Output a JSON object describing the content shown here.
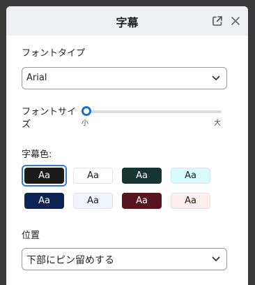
{
  "dialog": {
    "title": "字幕",
    "icons": {
      "popout": "external-link-icon",
      "close": "close-icon"
    }
  },
  "font_type": {
    "label": "フォントタイプ",
    "selected": "Arial"
  },
  "font_size": {
    "label": "フォントサイズ",
    "min_label": "小",
    "max_label": "大",
    "level": 0
  },
  "caption_color": {
    "label": "字幕色:",
    "selected_index": 0,
    "swatches": [
      {
        "text": "Aa",
        "bg": "#1b1b1b",
        "fg": "#ffffff"
      },
      {
        "text": "Aa",
        "bg": "#ffffff",
        "fg": "#1b1b1b"
      },
      {
        "text": "Aa",
        "bg": "#143530",
        "fg": "#ffffff"
      },
      {
        "text": "Aa",
        "bg": "#d6fbfb",
        "fg": "#1b1b1b"
      },
      {
        "text": "Aa",
        "bg": "#0f2352",
        "fg": "#ffffff"
      },
      {
        "text": "Aa",
        "bg": "#eef3ff",
        "fg": "#1b1b1b"
      },
      {
        "text": "Aa",
        "bg": "#571420",
        "fg": "#ffffff"
      },
      {
        "text": "Aa",
        "bg": "#fdeeee",
        "fg": "#1b1b1b"
      }
    ]
  },
  "position": {
    "label": "位置",
    "selected": "下部にピン留めする"
  }
}
